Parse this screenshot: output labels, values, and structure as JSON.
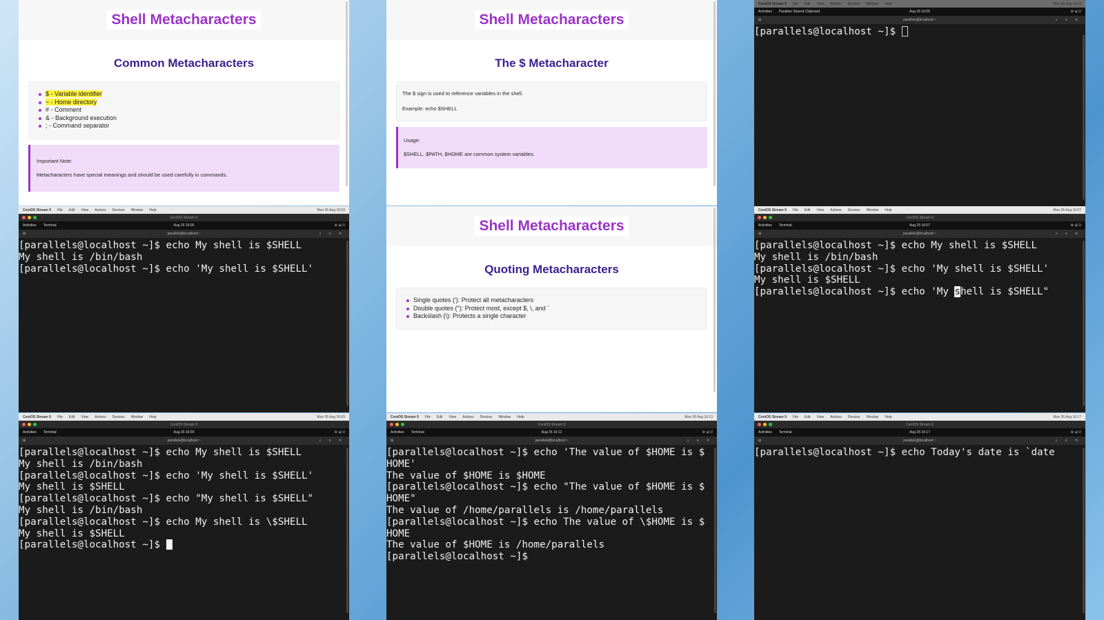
{
  "slides": {
    "s1": {
      "title": "Shell Metacharacters",
      "subtitle": "Common Metacharacters",
      "items": [
        "$ - Variable identifier",
        "~ - Home directory",
        "# - Comment",
        "& - Background execution",
        "; - Command separator"
      ],
      "note_title": "Important Note:",
      "note_text": "Metacharacters have special meanings and should be used carefully in commands."
    },
    "s2": {
      "title": "Shell Metacharacters",
      "subtitle": "The $ Metacharacter",
      "line1": "The $ sign is used to reference variables in the shell.",
      "line2": "Example: echo $SHELL",
      "note_title": "Usage:",
      "note_text": "$SHELL, $PATH, $HOME are common system variables."
    },
    "s3": {
      "title": "Shell Metacharacters",
      "subtitle": "Quoting Metacharacters",
      "items": [
        "Single quotes ('): Protect all metacharacters",
        "Double quotes (\"): Protect most, except $, \\, and `",
        "Backslash (\\): Protects a single character"
      ]
    }
  },
  "menubar": {
    "app": "CentOS Stream 9",
    "items": [
      "File",
      "Edit",
      "View",
      "Actions",
      "Devices",
      "Window",
      "Help"
    ],
    "vm_title": "CentOS Stream 9",
    "activities": "Activities",
    "terminal": "Terminal",
    "host": "parallels@localhost:~"
  },
  "terminals": {
    "t1": {
      "lines": [
        "[parallels@localhost ~]$ "
      ],
      "date": "Aug 26 16:05",
      "mac_time": "Mon 26 Aug 16:02",
      "clipboard": "Parallels Shared Clipboard"
    },
    "t2": {
      "lines": [
        "[parallels@localhost ~]$ echo My shell is $SHELL",
        "My shell is /bin/bash",
        "[parallels@localhost ~]$ echo 'My shell is $SHELL'"
      ],
      "date": "Aug 26 16:05",
      "mac_time": "Mon 26 Aug 16:03"
    },
    "t3": {
      "lines": [
        "[parallels@localhost ~]$ echo My shell is $SHELL",
        "My shell is /bin/bash",
        "[parallels@localhost ~]$ echo 'My shell is $SHELL'",
        "My shell is $SHELL"
      ],
      "last_prefix": "[parallels@localhost ~]$ echo 'My ",
      "last_sel": "s",
      "last_suffix": "hell is $SHELL\"",
      "date": "Aug 26 16:07",
      "mac_time": "Mon 26 Aug 16:07"
    },
    "t4": {
      "lines": [
        "[parallels@localhost ~]$ echo My shell is $SHELL",
        "My shell is /bin/bash",
        "[parallels@localhost ~]$ echo 'My shell is $SHELL'",
        "My shell is $SHELL",
        "[parallels@localhost ~]$ echo \"My shell is $SHELL\"",
        "My shell is /bin/bash",
        "[parallels@localhost ~]$ echo My shell is \\$SHELL",
        "My shell is $SHELL",
        "[parallels@localhost ~]$ "
      ],
      "date": "Aug 26 16:09",
      "mac_time": "Mon 26 Aug 16:09"
    },
    "t5": {
      "lines": [
        "[parallels@localhost ~]$ echo 'The value of $HOME is $",
        "HOME'",
        "The value of $HOME is $HOME",
        "[parallels@localhost ~]$ echo \"The value of $HOME is $",
        "HOME\"",
        "The value of /home/parallels is /home/parallels",
        "[parallels@localhost ~]$ echo The value of \\$HOME is $",
        "HOME",
        "The value of $HOME is /home/parallels",
        "[parallels@localhost ~]$ "
      ],
      "date": "Aug 26 16:12",
      "mac_time": "Mon 26 Aug 16:13"
    },
    "t6": {
      "lines": [
        "[parallels@localhost ~]$ echo Today's date is `date"
      ],
      "date": "Aug 26 16:17",
      "mac_time": "Mon 26 Aug 16:17"
    }
  }
}
